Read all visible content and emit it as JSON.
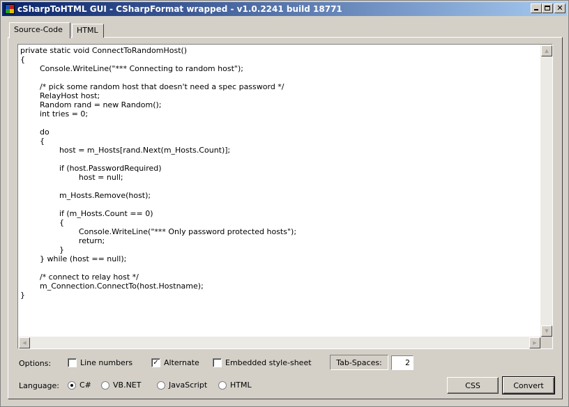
{
  "window": {
    "title": "cSharpToHTML GUI - CSharpFormat wrapped - v1.0.2241 build 18771"
  },
  "tabs": [
    {
      "label": "Source-Code",
      "active": true
    },
    {
      "label": "HTML",
      "active": false
    }
  ],
  "editor": {
    "code": "private static void ConnectToRandomHost()\n{\n\tConsole.WriteLine(\"*** Connecting to random host\");\n\n\t/* pick some random host that doesn't need a spec password */\n\tRelayHost host;\n\tRandom rand = new Random();\n\tint tries = 0;\n\n\tdo\n\t{\n\t\thost = m_Hosts[rand.Next(m_Hosts.Count)];\n\n\t\tif (host.PasswordRequired)\n\t\t\thost = null;\n\n\t\tm_Hosts.Remove(host);\n\n\t\tif (m_Hosts.Count == 0)\n\t\t{\n\t\t\tConsole.WriteLine(\"*** Only password protected hosts\");\n\t\t\treturn;\n\t\t}\n\t} while (host == null);\n\n\t/* connect to relay host */\n\tm_Connection.ConnectTo(host.Hostname);\n}"
  },
  "options": {
    "label": "Options:",
    "line_numbers": {
      "label": "Line numbers",
      "checked": false
    },
    "alternate": {
      "label": "Alternate",
      "checked": true
    },
    "embedded_stylesheet": {
      "label": "Embedded style-sheet",
      "checked": false
    },
    "tab_spaces_label": "Tab-Spaces:",
    "tab_spaces_value": "2"
  },
  "language": {
    "label": "Language:",
    "items": [
      {
        "label": "C#",
        "selected": true
      },
      {
        "label": "VB.NET",
        "selected": false
      },
      {
        "label": "JavaScript",
        "selected": false
      },
      {
        "label": "HTML",
        "selected": false
      }
    ]
  },
  "buttons": {
    "css": "CSS",
    "convert": "Convert"
  },
  "icons": {
    "app": "app-icon",
    "minimize": "minimize-icon",
    "maximize": "maximize-icon",
    "close": "close-icon",
    "scroll_up": "arrow-up-icon",
    "scroll_down": "arrow-down-icon",
    "scroll_left": "arrow-left-icon",
    "scroll_right": "arrow-right-icon"
  }
}
